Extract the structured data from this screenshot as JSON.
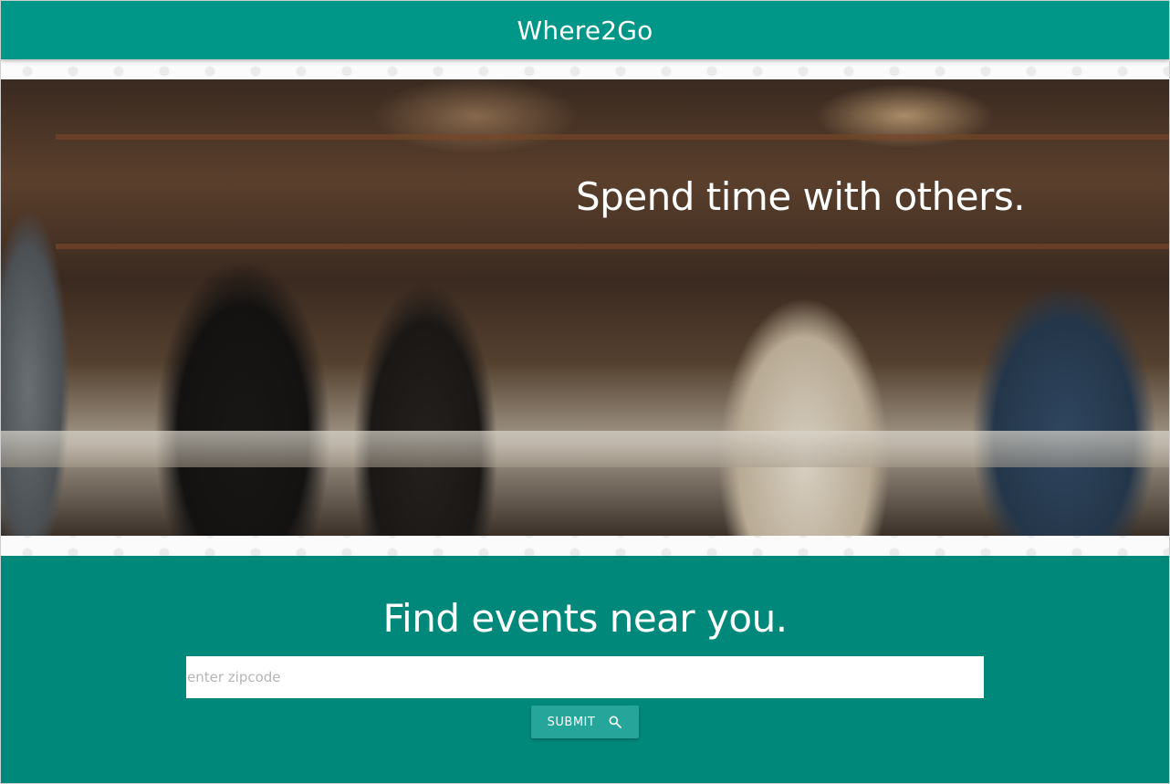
{
  "navbar": {
    "brand": "Where2Go"
  },
  "hero": {
    "tagline": "Spend time with others."
  },
  "search": {
    "heading": "Find events near you.",
    "placeholder": "enter zipcode",
    "value": "",
    "submit_label": "SUBMIT",
    "submit_icon": "search-icon"
  },
  "colors": {
    "navbar": "#009688",
    "section": "#00897b",
    "button": "#26a69a"
  }
}
